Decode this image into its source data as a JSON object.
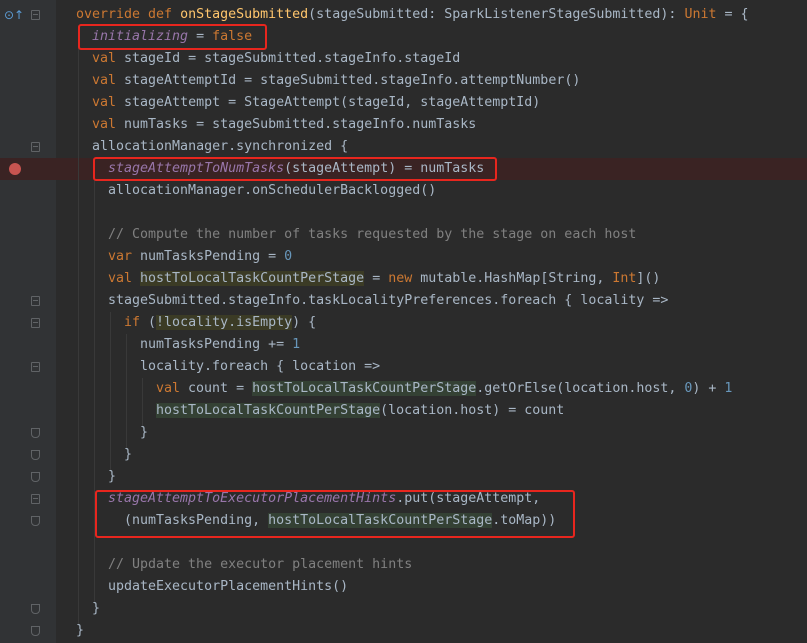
{
  "editor": {
    "lines": [
      {
        "id": "l1",
        "tokens": [
          [
            "override def ",
            "kw"
          ],
          [
            "onStageSubmitted",
            "fn"
          ],
          [
            "(stageSubmitted: SparkListenerStageSubmitted): ",
            ""
          ],
          [
            "Unit",
            "kw"
          ],
          [
            " = {",
            ""
          ]
        ]
      },
      {
        "id": "l2",
        "tokens": [
          [
            "initializing",
            "fld"
          ],
          [
            " = ",
            ""
          ],
          [
            "false",
            "kw"
          ]
        ]
      },
      {
        "id": "l3",
        "tokens": [
          [
            "val ",
            "kw"
          ],
          [
            "stageId = stageSubmitted.stageInfo.stageId",
            ""
          ]
        ]
      },
      {
        "id": "l4",
        "tokens": [
          [
            "val ",
            "kw"
          ],
          [
            "stageAttemptId = stageSubmitted.stageInfo.attemptNumber()",
            ""
          ]
        ]
      },
      {
        "id": "l5",
        "tokens": [
          [
            "val ",
            "kw"
          ],
          [
            "stageAttempt = StageAttempt(stageId, stageAttemptId)",
            ""
          ]
        ]
      },
      {
        "id": "l6",
        "tokens": [
          [
            "val ",
            "kw"
          ],
          [
            "numTasks = stageSubmitted.stageInfo.numTasks",
            ""
          ]
        ]
      },
      {
        "id": "l7",
        "tokens": [
          [
            "allocationManager.synchronized {",
            ""
          ]
        ]
      },
      {
        "id": "l8",
        "tokens": [
          [
            "stageAttemptToNumTasks",
            "fld"
          ],
          [
            "(stageAttempt) = numTasks",
            ""
          ]
        ]
      },
      {
        "id": "l9",
        "tokens": [
          [
            "allocationManager.onSchedulerBacklogged()",
            ""
          ]
        ]
      },
      {
        "id": "l10",
        "tokens": []
      },
      {
        "id": "l11",
        "tokens": [
          [
            "// Compute the number of tasks requested by the stage on each host",
            "cmt"
          ]
        ]
      },
      {
        "id": "l12",
        "tokens": [
          [
            "var ",
            "kw"
          ],
          [
            "numTasksPending = ",
            ""
          ],
          [
            "0",
            "num"
          ]
        ]
      },
      {
        "id": "l13",
        "tokens": [
          [
            "val ",
            "kw"
          ],
          [
            "hostToLocalTaskCountPerStage",
            "hl-warn"
          ],
          [
            " = ",
            ""
          ],
          [
            "new ",
            "kw"
          ],
          [
            "mutable.HashMap[String, ",
            ""
          ],
          [
            "Int",
            "typ"
          ],
          [
            "]()",
            ""
          ]
        ]
      },
      {
        "id": "l14",
        "tokens": [
          [
            "stageSubmitted.stageInfo.taskLocalityPreferences.foreach { locality =>",
            ""
          ]
        ]
      },
      {
        "id": "l15",
        "tokens": [
          [
            "if ",
            "kw"
          ],
          [
            "(",
            ""
          ],
          [
            "!locality.isEmpty",
            "hl-warn"
          ],
          [
            ") {",
            ""
          ]
        ]
      },
      {
        "id": "l16",
        "tokens": [
          [
            "numTasksPending += ",
            ""
          ],
          [
            "1",
            "num"
          ]
        ]
      },
      {
        "id": "l17",
        "tokens": [
          [
            "locality.foreach { location =>",
            ""
          ]
        ]
      },
      {
        "id": "l18",
        "tokens": [
          [
            "val ",
            "kw"
          ],
          [
            "count = ",
            ""
          ],
          [
            "hostToLocalTaskCountPerStage",
            "hl-var"
          ],
          [
            ".getOrElse(location.host, ",
            ""
          ],
          [
            "0",
            "num"
          ],
          [
            ") + ",
            ""
          ],
          [
            "1",
            "num"
          ]
        ]
      },
      {
        "id": "l19",
        "tokens": [
          [
            "hostToLocalTaskCountPerStage",
            "hl-var"
          ],
          [
            "(location.host) = count",
            ""
          ]
        ]
      },
      {
        "id": "l20",
        "tokens": [
          [
            "}",
            ""
          ]
        ]
      },
      {
        "id": "l21",
        "tokens": [
          [
            "}",
            ""
          ]
        ]
      },
      {
        "id": "l22",
        "tokens": [
          [
            "}",
            ""
          ]
        ]
      },
      {
        "id": "l23",
        "tokens": [
          [
            "stageAttemptToExecutorPlacementHints",
            "fld"
          ],
          [
            ".put(stageAttempt,",
            ""
          ]
        ]
      },
      {
        "id": "l24",
        "tokens": [
          [
            "(numTasksPending, ",
            ""
          ],
          [
            "hostToLocalTaskCountPerStage",
            "hl-var"
          ],
          [
            ".toMap))",
            ""
          ]
        ]
      },
      {
        "id": "l25",
        "tokens": []
      },
      {
        "id": "l26",
        "tokens": [
          [
            "// Update the executor placement hints",
            "cmt"
          ]
        ]
      },
      {
        "id": "l27",
        "tokens": [
          [
            "updateExecutorPlacementHints()",
            ""
          ]
        ]
      },
      {
        "id": "l28",
        "tokens": [
          [
            "}",
            ""
          ]
        ]
      },
      {
        "id": "l29",
        "tokens": [
          [
            "}",
            ""
          ]
        ]
      }
    ]
  },
  "colors": {
    "background": "#2b2b2b",
    "keyword": "#cc7832",
    "function": "#ffc66d",
    "field": "#9876aa",
    "number": "#6897bb",
    "comment": "#808080",
    "breakpoint": "#c75450",
    "annotation_box": "#e8261e"
  },
  "icons": {
    "override": "override-gutter-icon",
    "breakpoint": "breakpoint-icon"
  }
}
